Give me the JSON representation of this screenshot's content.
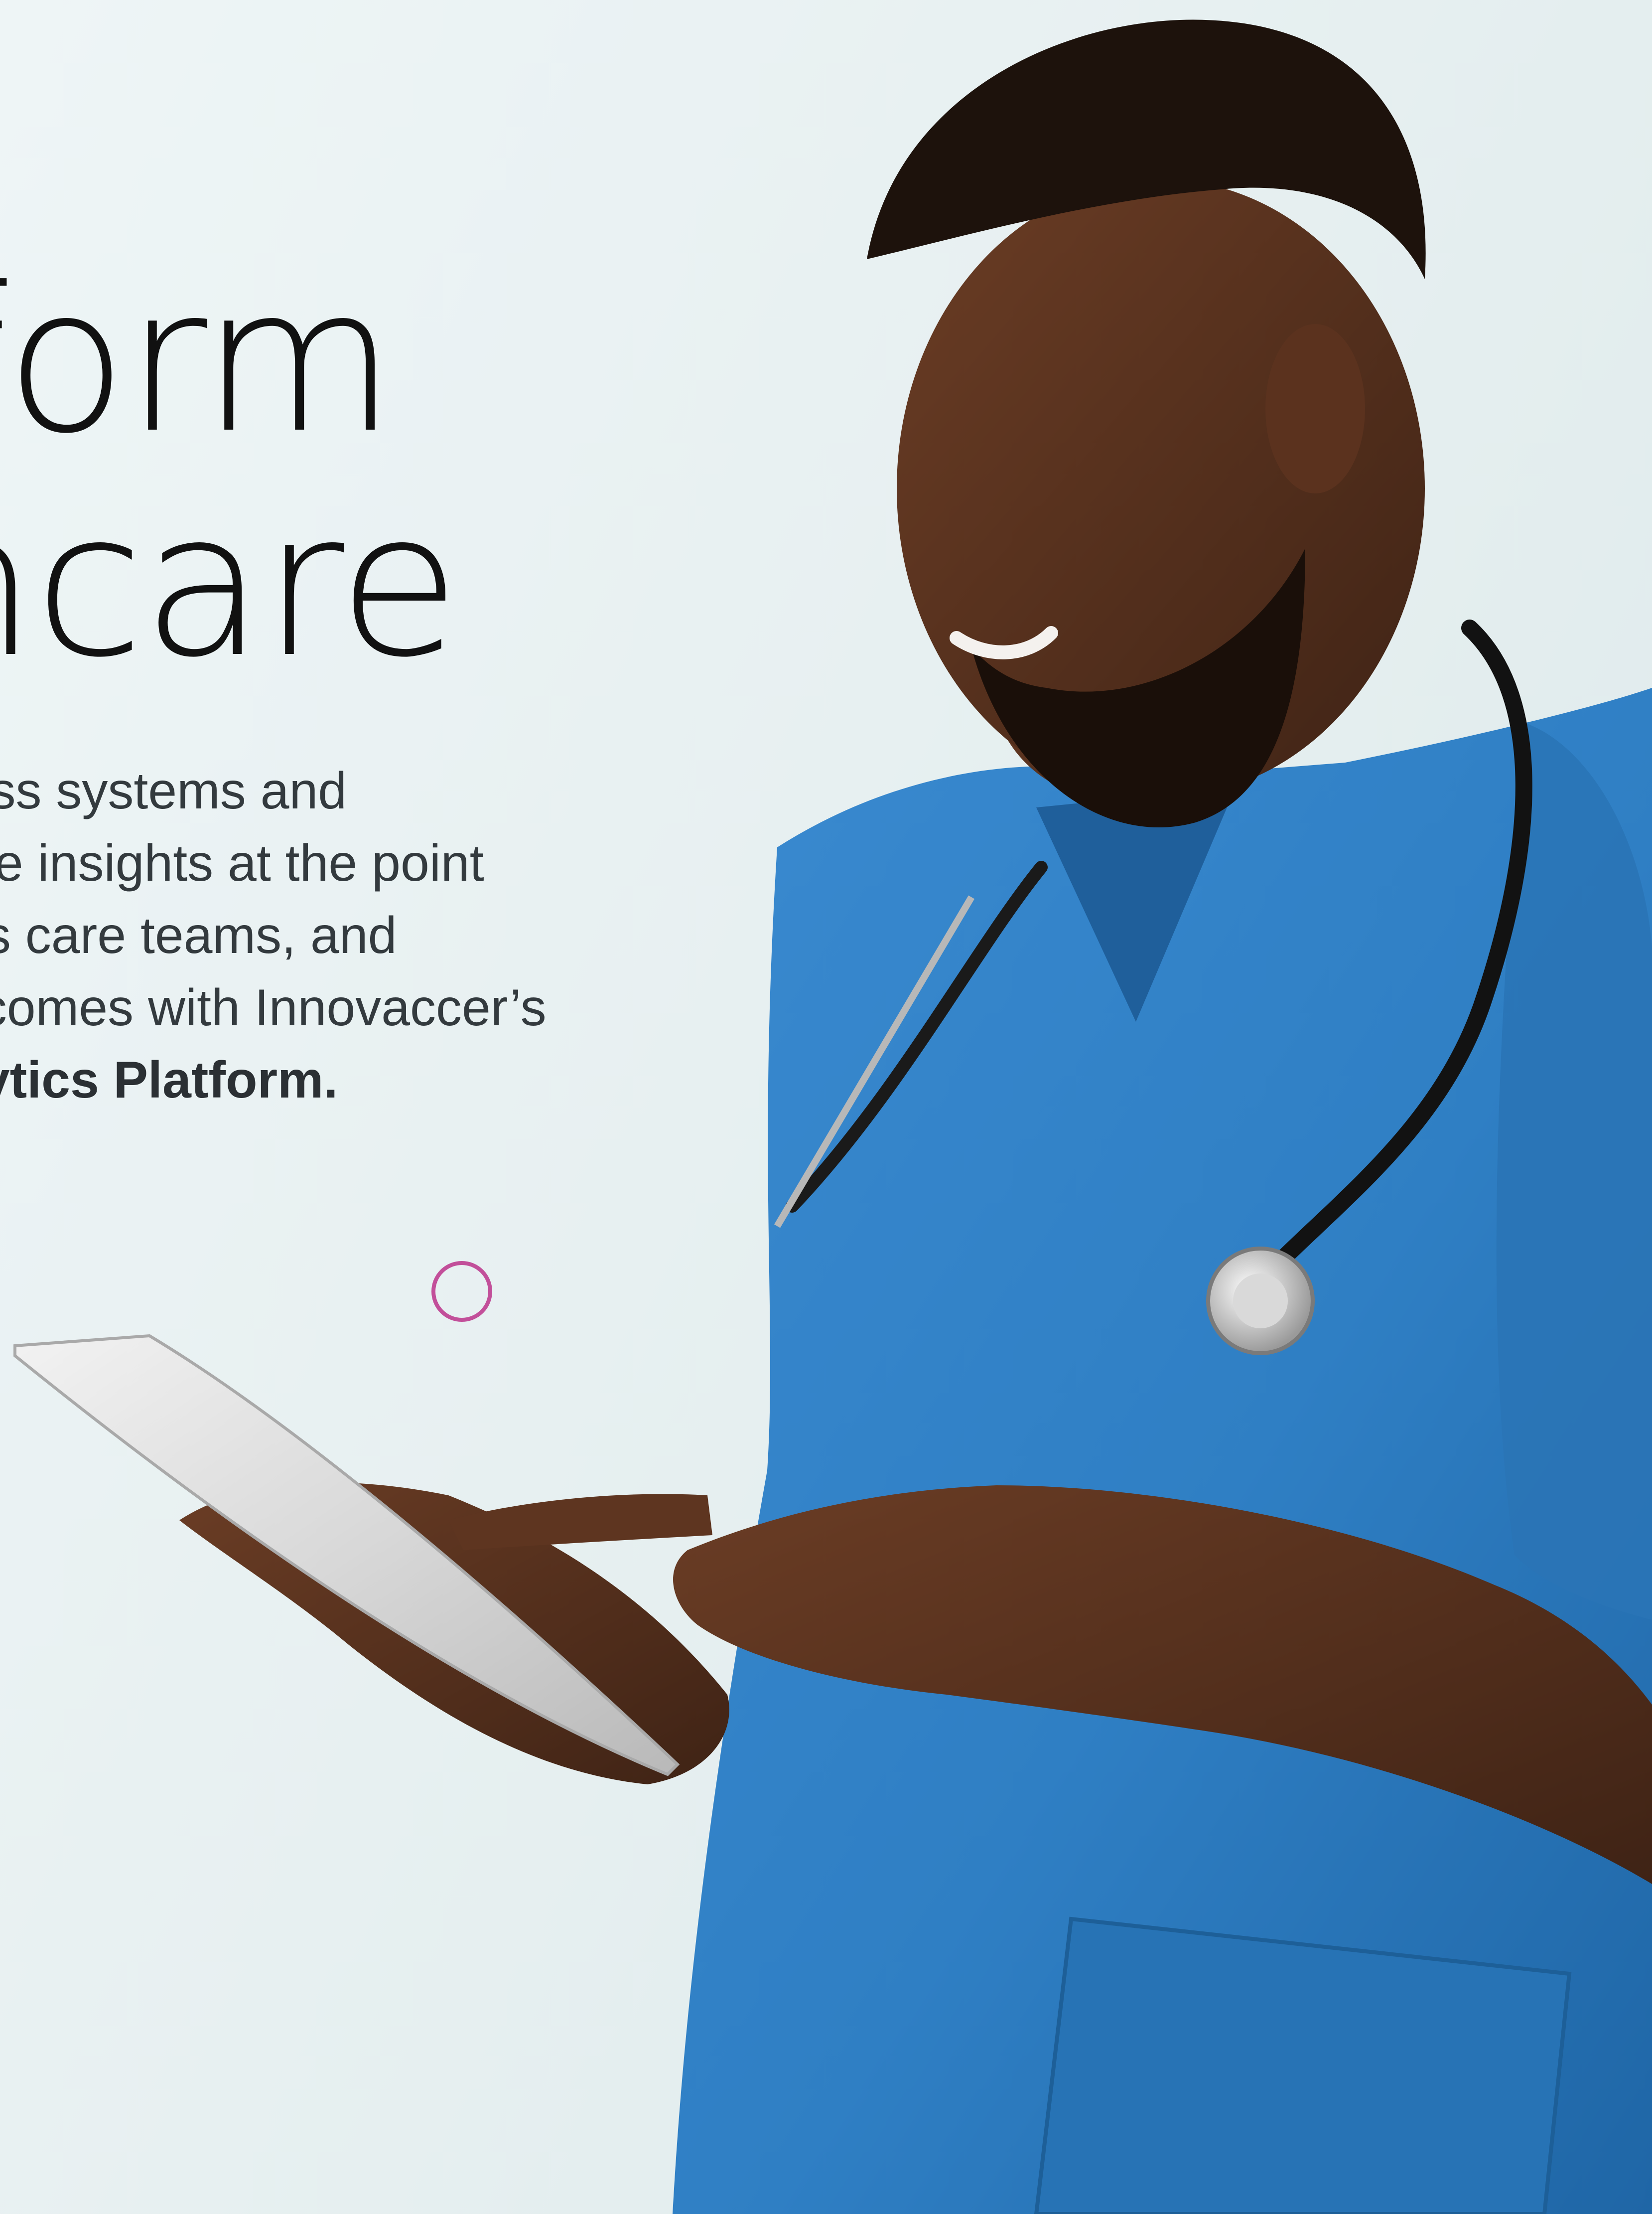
{
  "hero": {
    "headline_line_1": "Platform",
    "headline_line_2": "Healthcare",
    "body_lines": [
      "Unify data across systems and",
      "deliver actionable insights at the point",
      "of care, across care teams, and",
      "improve outcomes with Innovaccer’s"
    ],
    "body_bold": "Data & Analytics Platform.",
    "headline_line_1_visible": "atform",
    "headline_line_2_visible": "lthcare",
    "body_lines_visible": [
      "cross systems and",
      "able insights at the point",
      "oss care teams, and",
      "utcomes with Innovaccer’s"
    ],
    "body_bold_visible": "alytics Platform."
  },
  "decor": {
    "ring_icon": "circle-outline-icon",
    "ring_color": "#c24f9a"
  },
  "photo": {
    "subject_icon": "doctor-with-tablet-photo",
    "scrubs_color": "#2f7fc4",
    "skin_color": "#5a3420"
  }
}
